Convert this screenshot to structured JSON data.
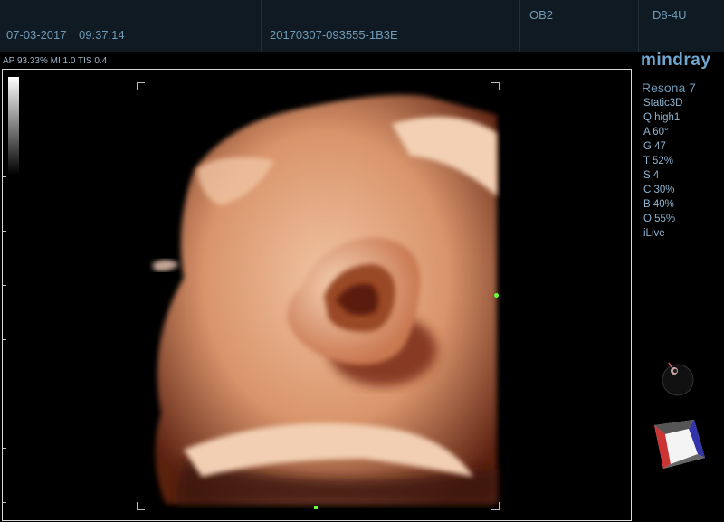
{
  "header": {
    "date": "07-03-2017",
    "time": "09:37:14",
    "patient_id": "20170307-093555-1B3E",
    "exam": "OB2",
    "probe": "D8-4U"
  },
  "info_line": "AP 93.33%  MI 1.0 TIS 0.4",
  "brand": "mindray",
  "model": "Resona 7",
  "params": [
    "Static3D",
    "Q high1",
    "A 60°",
    "G 47",
    "T 52%",
    "S 4",
    "C 30%",
    "B 40%",
    "O 55%",
    "iLive"
  ],
  "icons": {
    "orientation_ball": "orientation-ball-icon",
    "orientation_cube": "orientation-cube-icon"
  },
  "colors": {
    "topbar_bg": "#0f1a22",
    "label_text": "#6f9bb8",
    "brand": "#6fa6cf",
    "marker_green": "#66ff33",
    "skin": "#d9a07d"
  }
}
